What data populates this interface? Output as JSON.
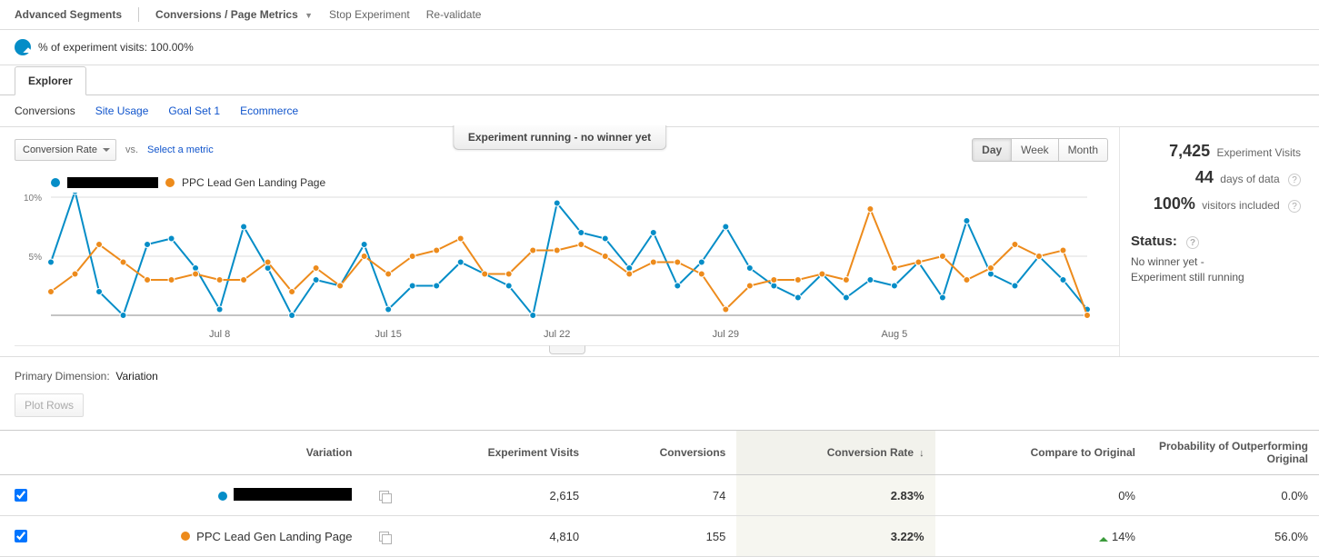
{
  "toolbar": {
    "advanced_segments": "Advanced Segments",
    "conversions_metrics": "Conversions / Page Metrics",
    "stop_experiment": "Stop Experiment",
    "revalidate": "Re-validate"
  },
  "segment_row": {
    "label": "% of experiment visits: 100.00%"
  },
  "explorer_tab": "Explorer",
  "subtabs": {
    "conversions": "Conversions",
    "site_usage": "Site Usage",
    "goal_set_1": "Goal Set 1",
    "ecommerce": "Ecommerce"
  },
  "metric_selector": "Conversion Rate",
  "vs_label": "vs.",
  "select_metric": "Select a metric",
  "experiment_bar": "Experiment running - no winner yet",
  "range_buttons": {
    "day": "Day",
    "week": "Week",
    "month": "Month"
  },
  "legend": {
    "series_a": "",
    "series_b": "PPC Lead Gen Landing Page"
  },
  "chart_data": {
    "type": "line",
    "xlabel": "",
    "ylabel": "",
    "ylim": [
      0,
      10
    ],
    "y_ticks": [
      "5%",
      "10%"
    ],
    "x_ticks": [
      "Jul 8",
      "Jul 15",
      "Jul 22",
      "Jul 29",
      "Aug 5"
    ],
    "categories_index": [
      0,
      1,
      2,
      3,
      4,
      5,
      6,
      7,
      8,
      9,
      10,
      11,
      12,
      13,
      14,
      15,
      16,
      17,
      18,
      19,
      20,
      21,
      22,
      23,
      24,
      25,
      26,
      27,
      28,
      29,
      30,
      31,
      32,
      33,
      34,
      35,
      36,
      37,
      38,
      39,
      40,
      41,
      42,
      43
    ],
    "series": [
      {
        "name": "(redacted original)",
        "color": "#058dc7",
        "values": [
          4.5,
          10.5,
          2.0,
          0.0,
          6.0,
          6.5,
          4.0,
          0.5,
          7.5,
          4.0,
          0.0,
          3.0,
          2.5,
          6.0,
          0.5,
          2.5,
          2.5,
          4.5,
          3.5,
          2.5,
          0.0,
          9.5,
          7.0,
          6.5,
          4.0,
          7.0,
          2.5,
          4.5,
          7.5,
          4.0,
          2.5,
          1.5,
          3.5,
          1.5,
          3.0,
          2.5,
          4.5,
          1.5,
          8.0,
          3.5,
          2.5,
          5.0,
          3.0,
          0.5
        ]
      },
      {
        "name": "PPC Lead Gen Landing Page",
        "color": "#ed8b1c",
        "values": [
          2.0,
          3.5,
          6.0,
          4.5,
          3.0,
          3.0,
          3.5,
          3.0,
          3.0,
          4.5,
          2.0,
          4.0,
          2.5,
          5.0,
          3.5,
          5.0,
          5.5,
          6.5,
          3.5,
          3.5,
          5.5,
          5.5,
          6.0,
          5.0,
          3.5,
          4.5,
          4.5,
          3.5,
          0.5,
          2.5,
          3.0,
          3.0,
          3.5,
          3.0,
          9.0,
          4.0,
          4.5,
          5.0,
          3.0,
          4.0,
          6.0,
          5.0,
          5.5,
          0.0
        ]
      }
    ]
  },
  "stats": {
    "visits_value": "7,425",
    "visits_label": "Experiment Visits",
    "days_value": "44",
    "days_label": "days of data",
    "pct_value": "100%",
    "pct_label": "visitors included"
  },
  "status": {
    "heading": "Status:",
    "line1": "No winner yet -",
    "line2": "Experiment still running"
  },
  "primary_dimension_label": "Primary Dimension:",
  "primary_dimension_value": "Variation",
  "plot_rows": "Plot Rows",
  "table": {
    "headers": {
      "variation": "Variation",
      "visits": "Experiment Visits",
      "conversions": "Conversions",
      "cr": "Conversion Rate",
      "compare": "Compare to Original",
      "prob": "Probability of Outperforming Original"
    },
    "rows": [
      {
        "color": "blue",
        "name": "",
        "name_redacted": true,
        "visits": "2,615",
        "conversions": "74",
        "cr": "2.83%",
        "compare": "0%",
        "compare_up": false,
        "prob": "0.0%"
      },
      {
        "color": "orange",
        "name": "PPC Lead Gen Landing Page",
        "name_redacted": false,
        "visits": "4,810",
        "conversions": "155",
        "cr": "3.22%",
        "compare": "14%",
        "compare_up": true,
        "prob": "56.0%"
      }
    ]
  }
}
